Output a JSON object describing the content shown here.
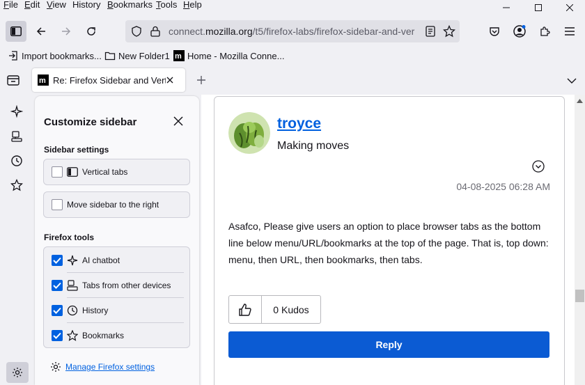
{
  "menubar": {
    "items": [
      {
        "first": "F",
        "rest": "ile"
      },
      {
        "first": "E",
        "rest": "dit"
      },
      {
        "first": "V",
        "rest": "iew"
      },
      {
        "first": "",
        "rest": "History",
        "ul_mid": "s"
      },
      {
        "first": "B",
        "rest": "ookmarks"
      },
      {
        "first": "T",
        "rest": "ools"
      },
      {
        "first": "H",
        "rest": "elp"
      }
    ]
  },
  "urlbar": {
    "prefix": "connect.",
    "domain": "mozilla.org",
    "path": "/t5/firefox-labs/firefox-sidebar-and-ver"
  },
  "bookmarks": {
    "items": [
      {
        "label": "Import bookmarks..."
      },
      {
        "label": "New Folder1"
      },
      {
        "label": "Home - Mozilla Conne..."
      }
    ]
  },
  "tab": {
    "title": "Re: Firefox Sidebar and Vertical"
  },
  "panel": {
    "title": "Customize sidebar",
    "settings_label": "Sidebar settings",
    "vertical_tabs": "Vertical tabs",
    "move_right": "Move sidebar to the right",
    "tools_label": "Firefox tools",
    "tools": [
      {
        "label": "AI chatbot",
        "checked": true
      },
      {
        "label": "Tabs from other devices",
        "checked": true
      },
      {
        "label": "History",
        "checked": true
      },
      {
        "label": "Bookmarks",
        "checked": true
      }
    ],
    "manage_link": "Manage Firefox settings"
  },
  "post": {
    "username": "troyce",
    "rank": "Making moves",
    "datetime": "04-08-2025 06:28 AM",
    "body": "Asafco, Please give users an option to place browser tabs as the bottom line below menu/URL/bookmarks at the top of the page. That is, top down: menu, then URL, then bookmarks, then tabs.",
    "kudos_count": "0",
    "kudos_label": "Kudos",
    "reply_label": "Reply"
  },
  "colors": {
    "accent": "#0061e0",
    "link": "#0060df",
    "reply_button": "#0b5bd3"
  }
}
